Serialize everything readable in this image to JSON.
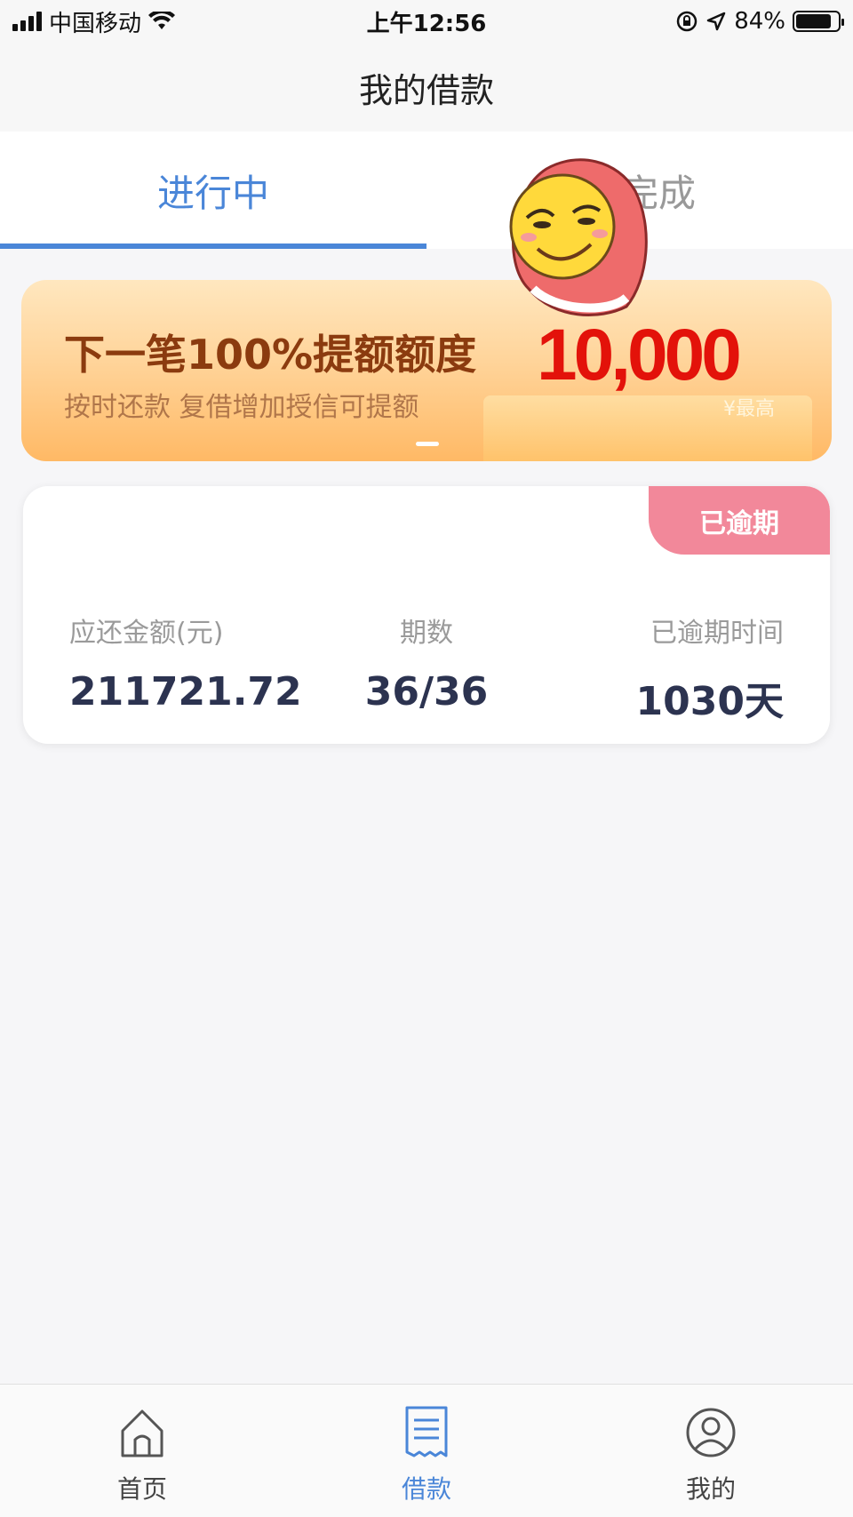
{
  "status_bar": {
    "carrier": "中国移动",
    "time": "上午12:56",
    "battery_percent": "84%",
    "battery_level": 0.84
  },
  "nav": {
    "title": "我的借款"
  },
  "tabs": [
    {
      "label": "进行中",
      "active": true
    },
    {
      "label": "已完成",
      "active": false
    }
  ],
  "banner": {
    "title": "下一笔100%提额额度",
    "subtitle": "按时还款  复借增加授信可提额",
    "amount": "10,000",
    "tag": "¥最高"
  },
  "loan_card": {
    "badge": "已逾期",
    "columns": [
      {
        "label": "应还金额(元)",
        "value": "211721.72"
      },
      {
        "label": "期数",
        "value": "36/36"
      },
      {
        "label": "已逾期时间",
        "value": "1030天"
      }
    ]
  },
  "tabbar": {
    "items": [
      {
        "label": "首页",
        "icon": "home-icon",
        "active": false
      },
      {
        "label": "借款",
        "icon": "bill-icon",
        "active": true
      },
      {
        "label": "我的",
        "icon": "user-icon",
        "active": false
      }
    ]
  },
  "colors": {
    "accent": "#4a86d8",
    "overdue": "#f2889a",
    "amount_red": "#e3120a",
    "value_text": "#2c3350"
  }
}
